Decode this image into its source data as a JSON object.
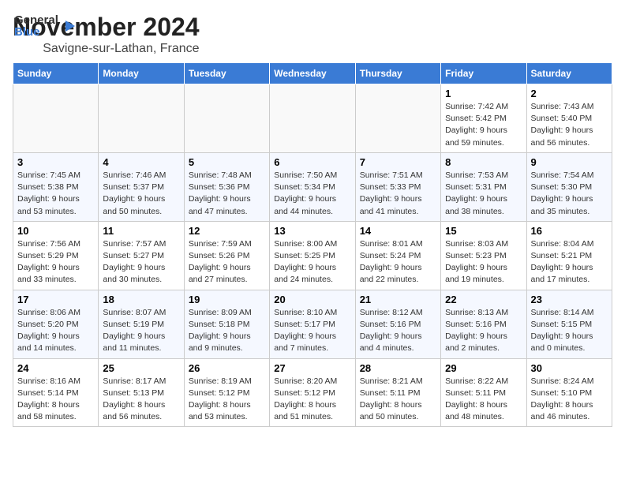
{
  "header": {
    "logo_general": "General",
    "logo_blue": "Blue",
    "month": "November 2024",
    "location": "Savigne-sur-Lathan, France"
  },
  "weekdays": [
    "Sunday",
    "Monday",
    "Tuesday",
    "Wednesday",
    "Thursday",
    "Friday",
    "Saturday"
  ],
  "weeks": [
    [
      {
        "day": "",
        "info": ""
      },
      {
        "day": "",
        "info": ""
      },
      {
        "day": "",
        "info": ""
      },
      {
        "day": "",
        "info": ""
      },
      {
        "day": "",
        "info": ""
      },
      {
        "day": "1",
        "info": "Sunrise: 7:42 AM\nSunset: 5:42 PM\nDaylight: 9 hours and 59 minutes."
      },
      {
        "day": "2",
        "info": "Sunrise: 7:43 AM\nSunset: 5:40 PM\nDaylight: 9 hours and 56 minutes."
      }
    ],
    [
      {
        "day": "3",
        "info": "Sunrise: 7:45 AM\nSunset: 5:38 PM\nDaylight: 9 hours and 53 minutes."
      },
      {
        "day": "4",
        "info": "Sunrise: 7:46 AM\nSunset: 5:37 PM\nDaylight: 9 hours and 50 minutes."
      },
      {
        "day": "5",
        "info": "Sunrise: 7:48 AM\nSunset: 5:36 PM\nDaylight: 9 hours and 47 minutes."
      },
      {
        "day": "6",
        "info": "Sunrise: 7:50 AM\nSunset: 5:34 PM\nDaylight: 9 hours and 44 minutes."
      },
      {
        "day": "7",
        "info": "Sunrise: 7:51 AM\nSunset: 5:33 PM\nDaylight: 9 hours and 41 minutes."
      },
      {
        "day": "8",
        "info": "Sunrise: 7:53 AM\nSunset: 5:31 PM\nDaylight: 9 hours and 38 minutes."
      },
      {
        "day": "9",
        "info": "Sunrise: 7:54 AM\nSunset: 5:30 PM\nDaylight: 9 hours and 35 minutes."
      }
    ],
    [
      {
        "day": "10",
        "info": "Sunrise: 7:56 AM\nSunset: 5:29 PM\nDaylight: 9 hours and 33 minutes."
      },
      {
        "day": "11",
        "info": "Sunrise: 7:57 AM\nSunset: 5:27 PM\nDaylight: 9 hours and 30 minutes."
      },
      {
        "day": "12",
        "info": "Sunrise: 7:59 AM\nSunset: 5:26 PM\nDaylight: 9 hours and 27 minutes."
      },
      {
        "day": "13",
        "info": "Sunrise: 8:00 AM\nSunset: 5:25 PM\nDaylight: 9 hours and 24 minutes."
      },
      {
        "day": "14",
        "info": "Sunrise: 8:01 AM\nSunset: 5:24 PM\nDaylight: 9 hours and 22 minutes."
      },
      {
        "day": "15",
        "info": "Sunrise: 8:03 AM\nSunset: 5:23 PM\nDaylight: 9 hours and 19 minutes."
      },
      {
        "day": "16",
        "info": "Sunrise: 8:04 AM\nSunset: 5:21 PM\nDaylight: 9 hours and 17 minutes."
      }
    ],
    [
      {
        "day": "17",
        "info": "Sunrise: 8:06 AM\nSunset: 5:20 PM\nDaylight: 9 hours and 14 minutes."
      },
      {
        "day": "18",
        "info": "Sunrise: 8:07 AM\nSunset: 5:19 PM\nDaylight: 9 hours and 11 minutes."
      },
      {
        "day": "19",
        "info": "Sunrise: 8:09 AM\nSunset: 5:18 PM\nDaylight: 9 hours and 9 minutes."
      },
      {
        "day": "20",
        "info": "Sunrise: 8:10 AM\nSunset: 5:17 PM\nDaylight: 9 hours and 7 minutes."
      },
      {
        "day": "21",
        "info": "Sunrise: 8:12 AM\nSunset: 5:16 PM\nDaylight: 9 hours and 4 minutes."
      },
      {
        "day": "22",
        "info": "Sunrise: 8:13 AM\nSunset: 5:16 PM\nDaylight: 9 hours and 2 minutes."
      },
      {
        "day": "23",
        "info": "Sunrise: 8:14 AM\nSunset: 5:15 PM\nDaylight: 9 hours and 0 minutes."
      }
    ],
    [
      {
        "day": "24",
        "info": "Sunrise: 8:16 AM\nSunset: 5:14 PM\nDaylight: 8 hours and 58 minutes."
      },
      {
        "day": "25",
        "info": "Sunrise: 8:17 AM\nSunset: 5:13 PM\nDaylight: 8 hours and 56 minutes."
      },
      {
        "day": "26",
        "info": "Sunrise: 8:19 AM\nSunset: 5:12 PM\nDaylight: 8 hours and 53 minutes."
      },
      {
        "day": "27",
        "info": "Sunrise: 8:20 AM\nSunset: 5:12 PM\nDaylight: 8 hours and 51 minutes."
      },
      {
        "day": "28",
        "info": "Sunrise: 8:21 AM\nSunset: 5:11 PM\nDaylight: 8 hours and 50 minutes."
      },
      {
        "day": "29",
        "info": "Sunrise: 8:22 AM\nSunset: 5:11 PM\nDaylight: 8 hours and 48 minutes."
      },
      {
        "day": "30",
        "info": "Sunrise: 8:24 AM\nSunset: 5:10 PM\nDaylight: 8 hours and 46 minutes."
      }
    ]
  ]
}
